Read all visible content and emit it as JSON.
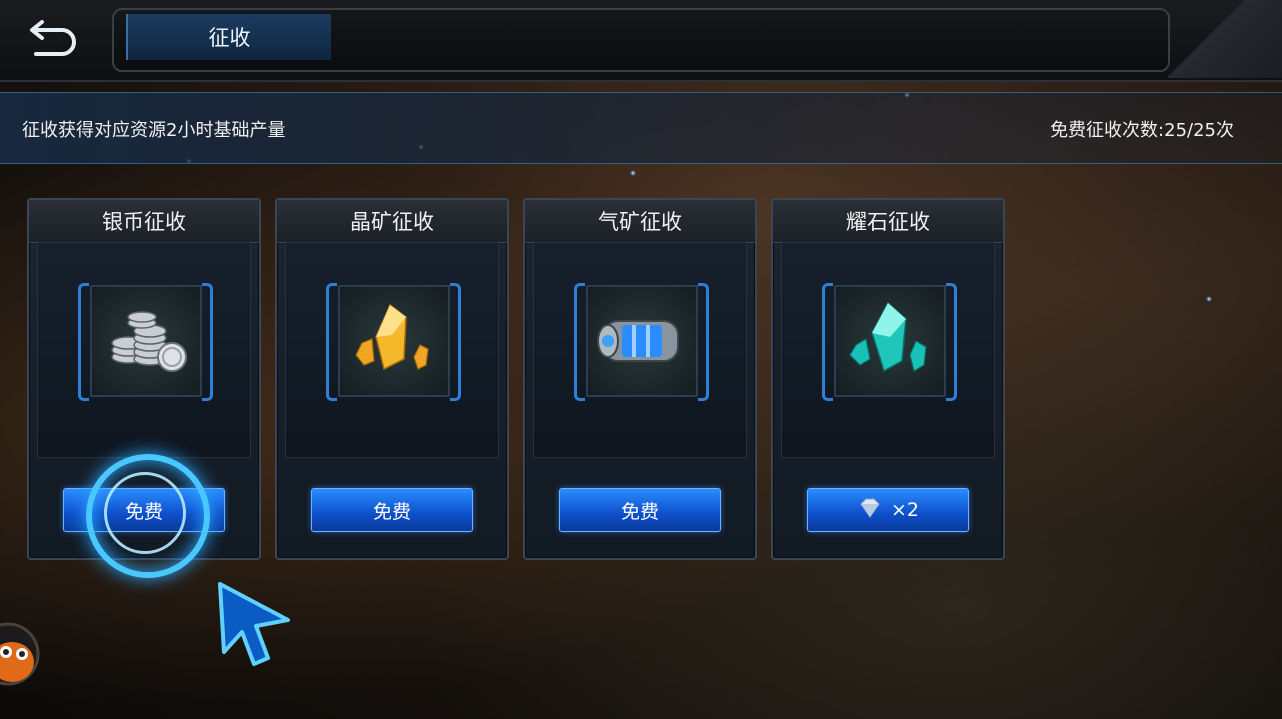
{
  "header": {
    "title": "征收"
  },
  "info": {
    "description": "征收获得对应资源2小时基础产量",
    "free_count": "免费征收次数:25/25次"
  },
  "cards": [
    {
      "title": "银币征收",
      "button_label": "免费",
      "icon": "silver-coins-icon"
    },
    {
      "title": "晶矿征收",
      "button_label": "免费",
      "icon": "crystal-ore-icon"
    },
    {
      "title": "气矿征收",
      "button_label": "免费",
      "icon": "gas-canister-icon"
    },
    {
      "title": "耀石征收",
      "button_label": "×2",
      "icon": "cyan-crystal-icon",
      "cost_icon": "diamond-icon"
    }
  ],
  "colors": {
    "accent": "#2b8cff",
    "ring": "#49c8ff",
    "bracket": "#2f7fd6"
  }
}
